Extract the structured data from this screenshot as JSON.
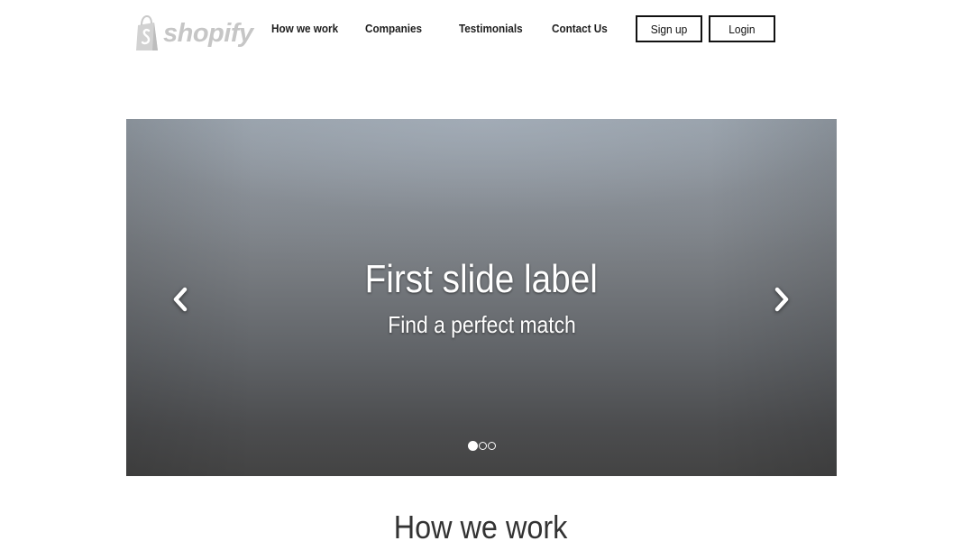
{
  "brand": {
    "name": "shopify",
    "logo_icon": "shopping-bag-icon",
    "logo_color": "#c6c6c6"
  },
  "nav": {
    "links": [
      {
        "label": "How we work"
      },
      {
        "label": "Companies"
      },
      {
        "label": "Testimonials"
      },
      {
        "label": "Contact Us"
      }
    ],
    "signup_label": "Sign up",
    "login_label": "Login"
  },
  "carousel": {
    "slide_title": "First slide label",
    "slide_subtitle": "Find a perfect match",
    "prev_icon": "chevron-left-icon",
    "next_icon": "chevron-right-icon",
    "slide_count": 3,
    "active_slide": 1
  },
  "sections": {
    "how_we_work_heading": "How we work"
  },
  "colors": {
    "text_dark": "#1e1e1e",
    "button_border": "#111111",
    "heading": "#333333"
  }
}
